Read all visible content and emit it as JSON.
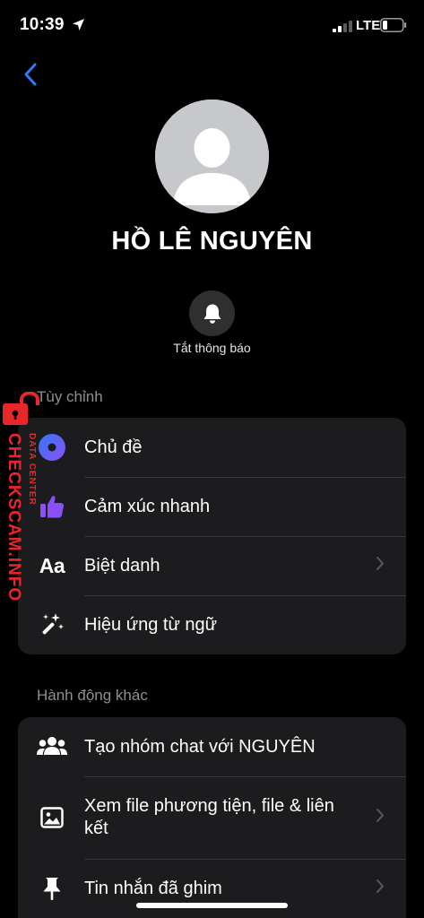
{
  "status_bar": {
    "time": "10:39",
    "network": "LTE"
  },
  "profile": {
    "name": "HỒ LÊ NGUYÊN"
  },
  "mute": {
    "label": "Tắt thông báo"
  },
  "sections": {
    "customize": {
      "title": "Tùy chỉnh",
      "items": [
        {
          "label": "Chủ đề",
          "icon": "theme-icon"
        },
        {
          "label": "Cảm xúc nhanh",
          "icon": "thumbs-up-icon"
        },
        {
          "label": "Biệt danh",
          "icon": "text-aa-icon"
        },
        {
          "label": "Hiệu ứng từ ngữ",
          "icon": "magic-wand-icon"
        }
      ]
    },
    "other_actions": {
      "title": "Hành động khác",
      "items": [
        {
          "label": "Tạo nhóm chat với NGUYÊN",
          "icon": "group-icon"
        },
        {
          "label": "Xem file phương tiện, file & liên kết",
          "icon": "image-icon"
        },
        {
          "label": "Tin nhắn đã ghim",
          "icon": "pin-icon"
        }
      ]
    }
  },
  "watermark": {
    "main": "CHECKSCAM.INFO",
    "sub": "DATA CENTER"
  },
  "colors": {
    "background": "#000000",
    "card": "#1c1c1e",
    "accent_blue": "#3478f6",
    "theme_purple": "#6a4cff",
    "reaction_purple": "#8c4ff5",
    "watermark_red": "#e8262b"
  }
}
